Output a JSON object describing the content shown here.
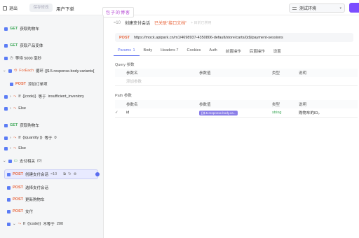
{
  "header": {
    "exit_label": "退出",
    "save_label": "保存修改",
    "title": "用户下单",
    "watermark": "包子的博客",
    "env": "测试环境"
  },
  "steps": [
    {
      "method": "GET",
      "label": "获取购物车"
    },
    {
      "method": "GET",
      "label": "获取产品变体"
    },
    {
      "label": "等待 5000 毫秒"
    },
    {
      "kw": "ForEach",
      "label": "循环 {{$.5.response.body.variants["
    },
    {
      "method": "POST",
      "label": "添加订单项"
    },
    {
      "kw": "If",
      "expr": "{{code}}",
      "op": "等于",
      "val": "insufficient_inventory"
    },
    {
      "kw": "Else"
    },
    {
      "method": "GET",
      "label": "获取购物车"
    },
    {
      "kw": "If",
      "expr": "{{quantity }}",
      "op": "等于",
      "val": "0"
    },
    {
      "kw": "Else"
    },
    {
      "label": "支付相关",
      "count": "(0)"
    },
    {
      "method": "POST",
      "label": "创建支付会话",
      "num": "≈10"
    },
    {
      "method": "POST",
      "label": "选择支付会话"
    },
    {
      "method": "POST",
      "label": "更新购物车"
    },
    {
      "method": "POST",
      "label": "支付"
    },
    {
      "kw": "If",
      "expr": "{{code}}",
      "op": "不等于",
      "val": "200"
    }
  ],
  "request": {
    "num": "≈10",
    "name": "创建支付会话",
    "linked": "已关联\"接口文档\"",
    "disabled": "+ 目前已禁用",
    "method": "POST",
    "url": "https://mock.apipark.cn/m1/4698937-4350806-default/store/carts/{id}/payment-sessions",
    "tabs": [
      {
        "label": "Params",
        "count": "1"
      },
      {
        "label": "Body"
      },
      {
        "label": "Headers",
        "count": "7"
      },
      {
        "label": "Cookies"
      },
      {
        "label": "Auth"
      },
      {
        "label": "前置操作"
      },
      {
        "label": "后置操作"
      },
      {
        "label": "设置"
      }
    ]
  },
  "query": {
    "label": "Query 参数",
    "headers": [
      "参数名",
      "参数值",
      "类型",
      "说明"
    ],
    "placeholder": "添加参数"
  },
  "path": {
    "label": "Path 参数",
    "headers": [
      "参数名",
      "参数值",
      "类型",
      "说明"
    ],
    "rows": [
      {
        "name": "id",
        "value": "{{$.5.response.body.ca...",
        "type": "string",
        "desc": "购物车的ID。"
      }
    ]
  },
  "colors": {
    "accent": "#5b6df0",
    "get": "#3aa655",
    "post": "#e8643a"
  }
}
